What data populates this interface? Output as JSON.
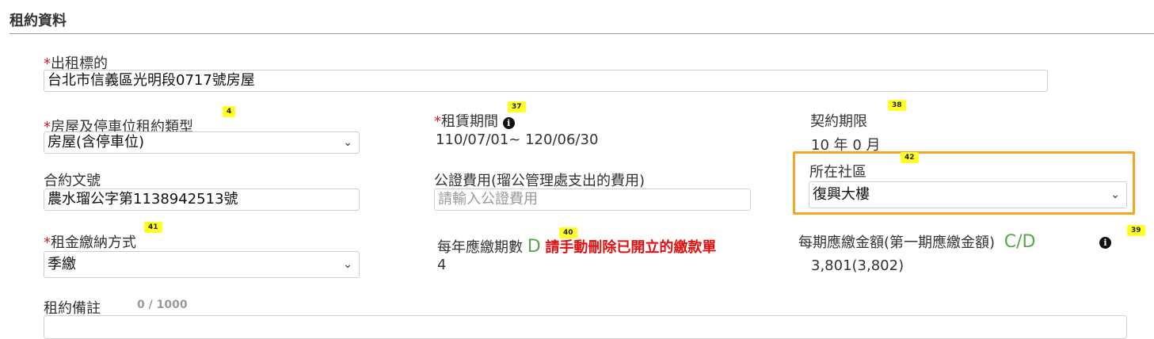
{
  "section": {
    "title": "租約資料"
  },
  "rental_target": {
    "label": "出租標的",
    "value": "台北市信義區光明段0717號房屋"
  },
  "lease_type": {
    "label": "房屋及停車位租約類型",
    "badge": "4",
    "value": "房屋(含停車位)"
  },
  "lease_period": {
    "label": "租賃期間",
    "badge": "37",
    "value": "110/07/01~ 120/06/30"
  },
  "contract_term": {
    "label": "契約期限",
    "badge": "38",
    "value": "10 年 0 月"
  },
  "contract_no": {
    "label": "合約文號",
    "value": "農水瑠公字第1138942513號"
  },
  "public_fee": {
    "label": "公證費用(瑠公管理處支出的費用)",
    "placeholder": "請輸入公證費用"
  },
  "community": {
    "label": "所在社區",
    "badge": "42",
    "value": "復興大樓"
  },
  "payment_method": {
    "label": "租金繳納方式",
    "badge": "41",
    "value": "季繳"
  },
  "annual_periods": {
    "label": "每年應繳期數",
    "tag": "D",
    "badge": "40",
    "warning": "請手動刪除已開立的繳款單",
    "value": "4"
  },
  "period_amount": {
    "label": "每期應繳金額(第一期應繳金額)",
    "tag": "C/D",
    "badge": "39",
    "value": "3,801(3,802)"
  },
  "notes": {
    "label": "租約備註",
    "counter": "0 / 1000"
  },
  "icons": {
    "info": "info-circle-icon",
    "chevron": "chevron-down-icon"
  },
  "colors": {
    "required": "#d32020",
    "highlight": "#f5a623",
    "badge": "#ffff22",
    "tag_green": "#5ba34e",
    "warning": "#e01010"
  }
}
